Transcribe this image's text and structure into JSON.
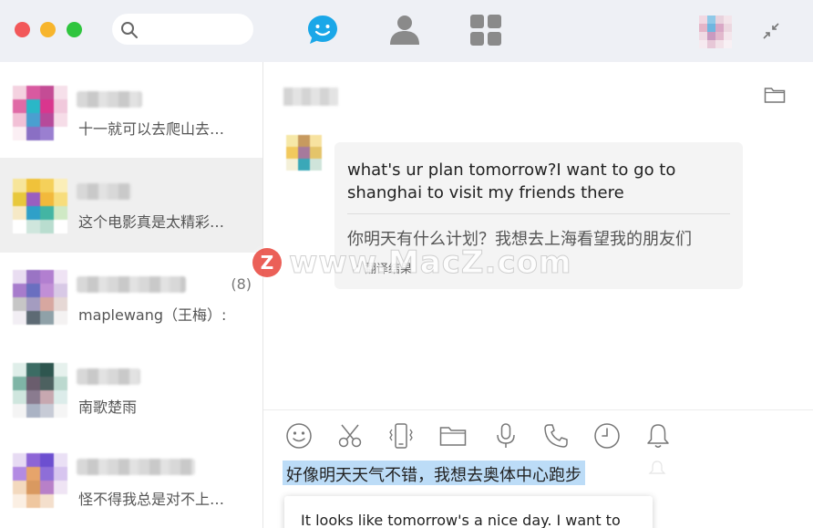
{
  "search": {
    "placeholder": ""
  },
  "nav": {
    "chat_icon": "chat-bubble-smile-icon",
    "contacts_icon": "person-icon",
    "apps_icon": "grid-icon",
    "accent": "#1aa7e8"
  },
  "conversations": [
    {
      "preview": "十一就可以去爬山去…",
      "active": false,
      "badge": ""
    },
    {
      "preview": "这个电影真是太精彩…",
      "active": true,
      "badge": ""
    },
    {
      "preview": "maplewang（王梅）:",
      "active": false,
      "badge": "(8)"
    },
    {
      "preview": "南歌楚雨",
      "active": false,
      "badge": ""
    },
    {
      "preview": "怪不得我总是对不上…",
      "active": false,
      "badge": ""
    }
  ],
  "message": {
    "english": "what's ur plan tomorrow?I want to go to shanghai to visit my friends there",
    "chinese": "你明天有什么计划？我想去上海看望我的朋友们",
    "tag": "✓ 翻译结果"
  },
  "watermark": {
    "letter": "Z",
    "text": "www.MacZ.com"
  },
  "toolbar": [
    "smiley-icon",
    "scissors-icon",
    "vibrate-icon",
    "folder-icon",
    "microphone-icon",
    "phone-icon",
    "clock-icon",
    "bell-icon"
  ],
  "composer": {
    "selected_text": "好像明天天气不错，我想去奥体中心跑步",
    "translation": "It looks like tomorrow's a nice day. I want to"
  }
}
